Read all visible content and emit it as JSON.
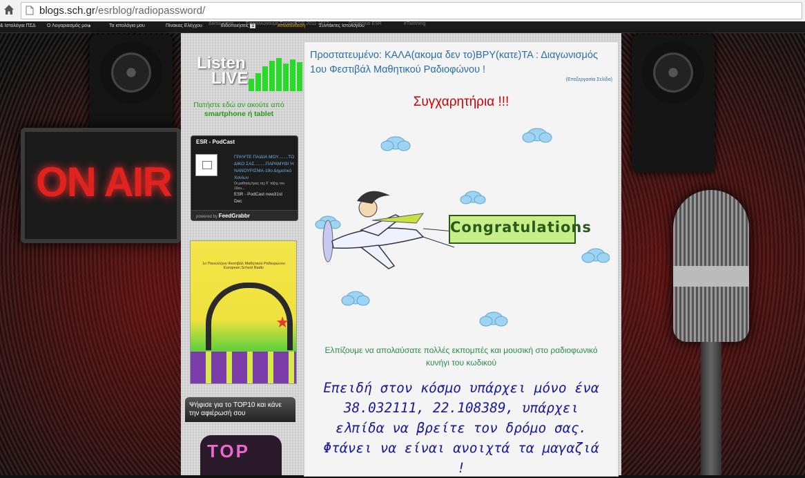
{
  "browser": {
    "url_domain": "blogs.sch.gr",
    "url_path": "/esrblog/radiopassword/"
  },
  "navbar": {
    "items": [
      "& Ιστολόγια ΠΣΔ",
      "Ο Λογαριασμός μου",
      "Τα ιστολόγια μου",
      "Πίνακας Ελέγχου",
      "Ειδοποιήσεις",
      "Αποσύνδεση",
      "Συντάκτες Ιστολογίου"
    ],
    "notifications_count": "1",
    "faded_items": [
      "Δικτυωμένο",
      "Επικοινωνούμε Σχολικά",
      "ESR 2011-2012",
      "Comenius ESR",
      "eTwinning"
    ]
  },
  "sidebar": {
    "listen_live_word1": "Listen",
    "listen_live_word2": "LIVE",
    "listen_caption_line1": "Πατήστε εδώ αν ακούτε από",
    "listen_caption_line2": "smartphone ή tablet",
    "podcast_widget": {
      "title": "ESR - PodCast",
      "entry_title": "ΓΡΑΨΤΕ ΠΑΙΔΙΑ ΜΟΥ........ΤΟ ΔΙΚΟ ΣΑΣ.........ΠΑΡΑΜΥΘΙ Ή ΝΑΝΟΥΡΙΣΜΑ-19ο Δημοτικό Χανίων",
      "entry_snippet": "Οι μαθητές/τριες της δ΄ τάξης του 19ου...",
      "next_entry": "ESR - PodCast new31st",
      "next_entry_cut": "Dec",
      "footer_prefix": "powered by",
      "footer_brand": "FeedGrabbr"
    },
    "poster_caption": "1o Πανελλήνιο Φεστιβάλ Μαθητικού Ραδιοφώνου European School Radio",
    "vote_text": "Ψήφισε για το TOP10 και κάνε την αφιέρωσή σου",
    "top10_text": "TOP"
  },
  "post": {
    "title": "Προστατευμένο: ΚΑΛΑ(ακομα δεν το)ΒΡΥ(κατε)ΤΑ : Διαγωνισμός 1ου Φεστιβάλ Μαθητικού Ραδιοφώνου !",
    "edit_link": "(Επεξεργασία Σελίδα)",
    "congrats_heading": "Συγχαρητήρια !!!",
    "banner_text": "Congratulations",
    "hope_line1": "Ελπίζουμε να απολαύσατε πολλές εκπομπές και μουσική στο ραδιοφωνικό",
    "hope_line2": "κυνήγι του κωδικού",
    "riddle": "Επειδή στον κόσμο υπάρχει μόνο ένα 38.032111, 22.108389, υπάρχει ελπίδα να βρείτε τον δρόμο σας. Φτάνει να είναι ανοιχτά τα μαγαζιά !"
  },
  "background": {
    "onair_text": "ON AIR"
  },
  "colors": {
    "title_blue": "#2a6da8",
    "congrats_red": "#cc0000",
    "hope_green": "#2a8a4a",
    "riddle_blue": "#1a1a9a",
    "listen_green": "#2a9a1a"
  }
}
